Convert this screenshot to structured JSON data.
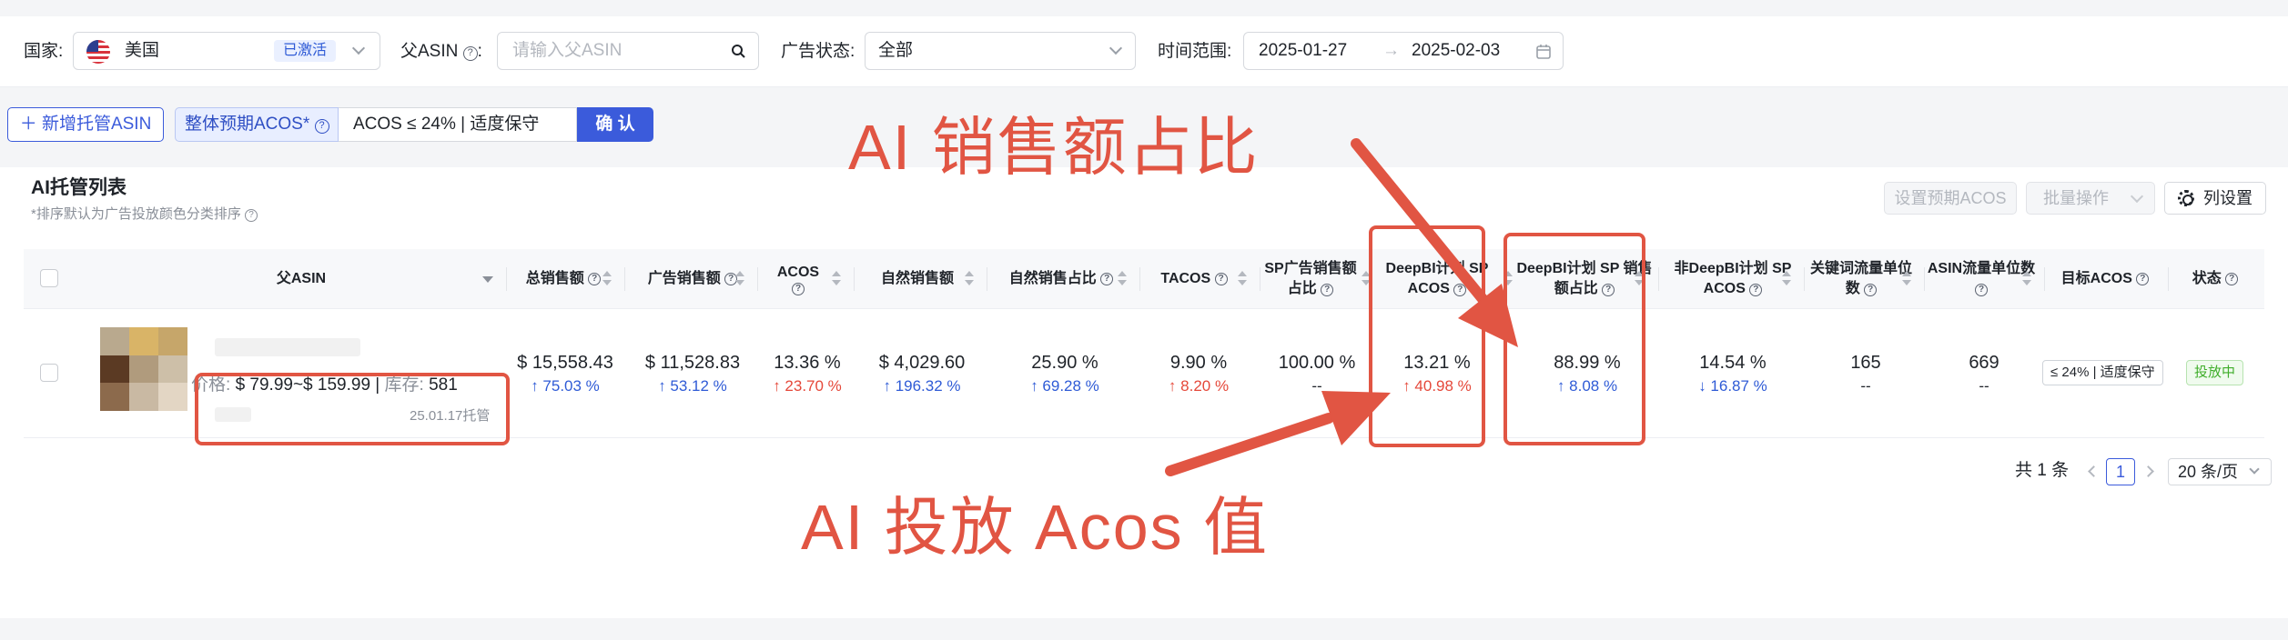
{
  "filters": {
    "country_label": "国家:",
    "country_value": "美国",
    "country_status": "已激活",
    "parent_asin_label": "父ASIN",
    "parent_asin_placeholder": "请输入父ASIN",
    "ad_status_label": "广告状态:",
    "ad_status_value": "全部",
    "time_label": "时间范围:",
    "date_start": "2025-01-27",
    "date_arrow": "→",
    "date_end": "2025-02-03"
  },
  "actions": {
    "add_button": "＋  新增托管ASIN",
    "acos_label": "整体预期ACOS*",
    "acos_value": "ACOS ≤ 24% | 适度保守",
    "confirm_button": "确 认"
  },
  "list": {
    "title": "AI托管列表",
    "subtitle": "*排序默认为广告投放颜色分类排序",
    "set_acos_button": "设置预期ACOS",
    "batch_button": "批量操作",
    "column_settings_button": "列设置"
  },
  "columns": [
    "父ASIN",
    "总销售额",
    "广告销售额",
    "ACOS",
    "自然销售额",
    "自然销售占比",
    "TACOS",
    "SP广告销售额占比",
    "DeepBI计划 SP ACOS",
    "DeepBI计划 SP 销售额占比",
    "非DeepBI计划 SP ACOS",
    "关键词流量单位数",
    "ASIN流量单位数",
    "目标ACOS",
    "状态"
  ],
  "row": {
    "price_label": "价格:",
    "price_value": "$ 79.99~$ 159.99",
    "stock_sep": " | ",
    "stock_label": "库存:",
    "stock_value": "581",
    "managed_date": "25.01.17托管",
    "total_sales": "$ 15,558.43",
    "total_sales_change": "↑ 75.03 %",
    "ad_sales": "$ 11,528.83",
    "ad_sales_change": "↑ 53.12 %",
    "acos": "13.36 %",
    "acos_change": "↑ 23.70 %",
    "organic_sales": "$ 4,029.60",
    "organic_sales_change": "↑ 196.32 %",
    "organic_ratio": "25.90 %",
    "organic_ratio_change": "↑ 69.28 %",
    "tacos": "9.90 %",
    "tacos_change": "↑ 8.20 %",
    "sp_ad_ratio": "100.00 %",
    "sp_ad_ratio_change": "--",
    "deepbi_sp_acos": "13.21 %",
    "deepbi_sp_acos_change": "↑ 40.98 %",
    "deepbi_sp_sales_ratio": "88.99 %",
    "deepbi_sp_sales_ratio_change": "↑ 8.08 %",
    "non_deepbi_sp_acos": "14.54 %",
    "non_deepbi_sp_acos_change": "↓ 16.87 %",
    "keyword_units": "165",
    "keyword_units_change": "--",
    "asin_units": "669",
    "asin_units_change": "--",
    "target_acos": "≤ 24% | 适度保守",
    "status": "投放中"
  },
  "pagination": {
    "total": "共 1 条",
    "current_page": "1",
    "page_size": "20 条/页"
  },
  "annotations": {
    "top": "AI 销售额占比",
    "bottom": "AI 投放 Acos 值"
  },
  "colors": {
    "primary": "#3b5bdb",
    "up_blue": "#2f5bd6",
    "up_red": "#e5483a",
    "annotation": "#e15543",
    "status_green": "#3fae2a"
  }
}
